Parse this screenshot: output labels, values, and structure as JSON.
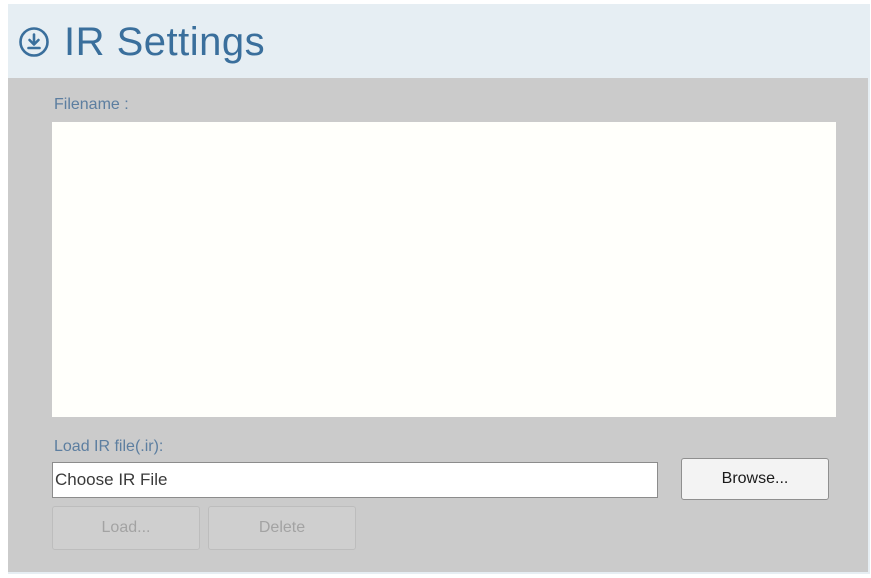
{
  "header": {
    "title": "IR Settings",
    "icon": "download-circle-icon",
    "title_color": "#3a6f9c"
  },
  "panel": {
    "filename_label": "Filename :",
    "load_label": "Load IR file(.ir):",
    "file_input": {
      "value": "",
      "placeholder": "Choose IR File"
    },
    "browse_label": "Browse...",
    "load_button_label": "Load...",
    "delete_button_label": "Delete"
  },
  "colors": {
    "background": "#e6eef3",
    "panel": "#cbcbcb",
    "label": "#5c7ea0",
    "disabled_text": "#a3a3a3"
  }
}
